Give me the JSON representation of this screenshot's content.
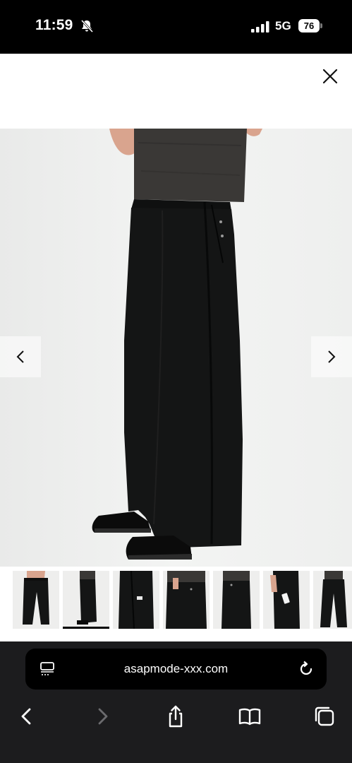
{
  "status_bar": {
    "time": "11:59",
    "network": "5G",
    "battery": "76",
    "icons": [
      "bell-slash-icon",
      "signal-bars-icon",
      "battery-icon"
    ]
  },
  "modal": {
    "close_icon": "close-icon"
  },
  "gallery": {
    "prev_icon": "chevron-left-icon",
    "next_icon": "chevron-right-icon",
    "thumbnail_count": 7,
    "active_thumbnail": 2
  },
  "browser": {
    "url": "asapmode-xxx.com",
    "icons": [
      "tabs-icon",
      "reload-icon",
      "back-icon",
      "forward-icon",
      "share-icon",
      "bookmarks-icon",
      "tabs-overview-icon"
    ],
    "forward_disabled": true
  },
  "colors": {
    "photo_background": "#eeefee",
    "chrome_background": "#1c1c1e",
    "garment": "#141515",
    "tshirt": "#3a3836"
  }
}
